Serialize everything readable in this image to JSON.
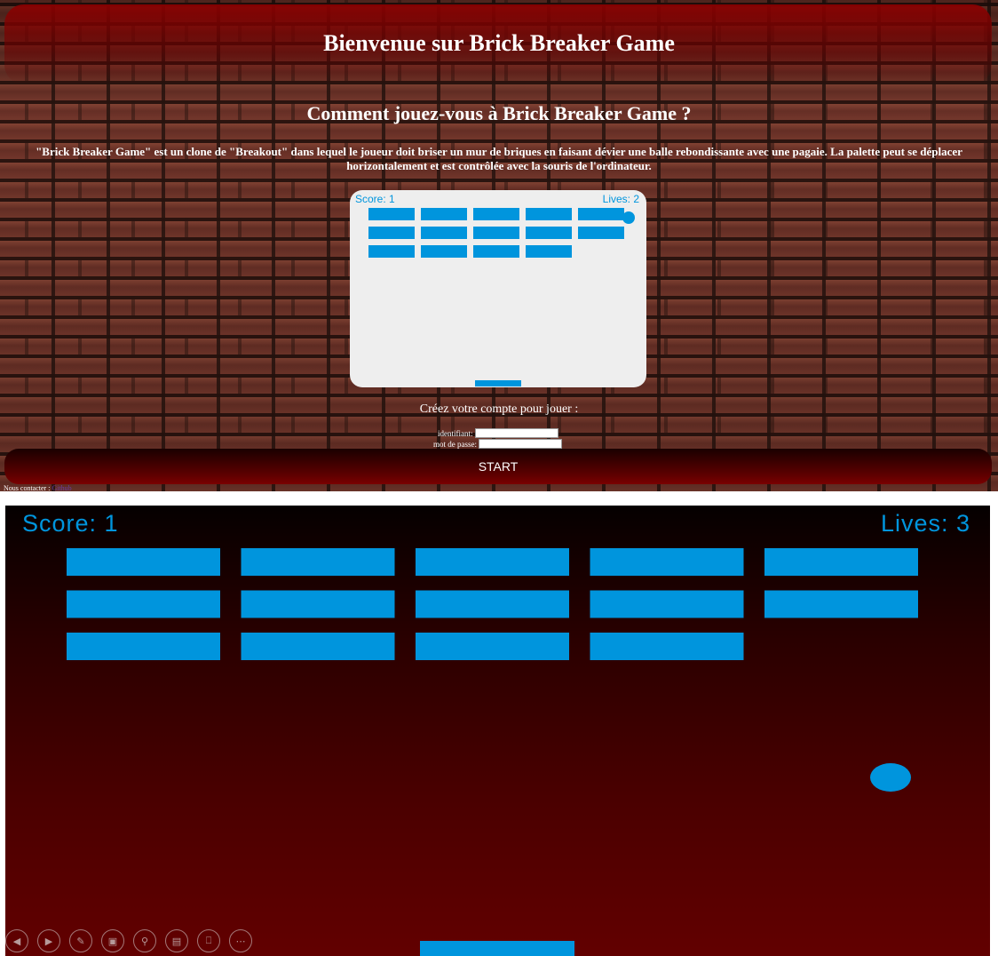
{
  "page": {
    "title": "Bienvenue sur Brick Breaker Game",
    "how_title": "Comment jouez-vous à Brick Breaker Game ?",
    "description": "\"Brick Breaker Game\" est un clone de \"Breakout\" dans lequel le joueur doit briser un mur de briques en faisant dévier une balle rebondissante avec une pagaie. La palette peut se déplacer horizontalement et est contrôlée avec la souris de l'ordinateur.",
    "signup_text": "Créez votre compte pour jouer :",
    "identifiant_label": "identifiant:",
    "password_label": "mot de passe:",
    "start_label": "START",
    "footer_text": "Nous contacter :",
    "footer_link": "Github"
  },
  "mini_game": {
    "score_text": "Score: 1",
    "lives_text": "Lives: 2",
    "brick_color": "#0095DD",
    "background": "#eeeeee",
    "bricks_present": [
      [
        true,
        true,
        true,
        true,
        true
      ],
      [
        true,
        true,
        true,
        true,
        true
      ],
      [
        true,
        true,
        true,
        true,
        false
      ]
    ]
  },
  "big_game": {
    "score_text": "Score: 1",
    "lives_text": "Lives: 3",
    "brick_color": "#0095DD",
    "bricks_present": [
      [
        true,
        true,
        true,
        true,
        true
      ],
      [
        true,
        true,
        true,
        true,
        true
      ],
      [
        true,
        true,
        true,
        true,
        false
      ]
    ]
  },
  "toolbar": {
    "icons": [
      "previous-icon",
      "next-icon",
      "pen-icon",
      "slides-icon",
      "zoom-icon",
      "subtitles-icon",
      "camera-off-icon",
      "more-icon"
    ]
  },
  "colors": {
    "accent": "#0095DD",
    "header_red": "#8c0000"
  }
}
